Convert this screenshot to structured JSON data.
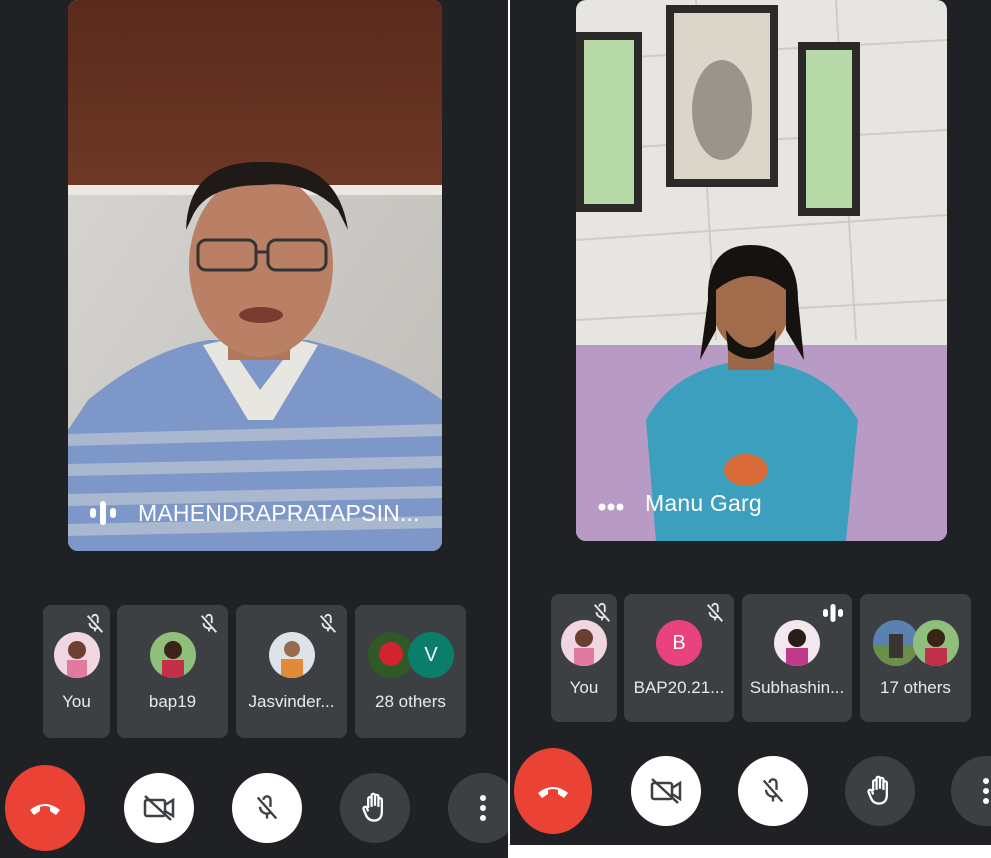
{
  "left": {
    "speaker": {
      "name": "MAHENDRAPRATAPSIN..."
    },
    "participants": [
      {
        "label": "You"
      },
      {
        "label": "bap19"
      },
      {
        "label": "Jasvinder..."
      },
      {
        "label": "28 others",
        "avatar_letter": "V"
      }
    ]
  },
  "right": {
    "speaker": {
      "name": "Manu Garg"
    },
    "participants": [
      {
        "label": "You"
      },
      {
        "label": "BAP20.21...",
        "avatar_letter": "B"
      },
      {
        "label": "Subhashin..."
      },
      {
        "label": "17 others"
      }
    ]
  },
  "colors": {
    "panel_bg": "#202124",
    "tile_bg": "#3c4043",
    "end_call": "#ea4335",
    "avatar_b": "#e8437d",
    "avatar_v": "#0b7d6b"
  }
}
